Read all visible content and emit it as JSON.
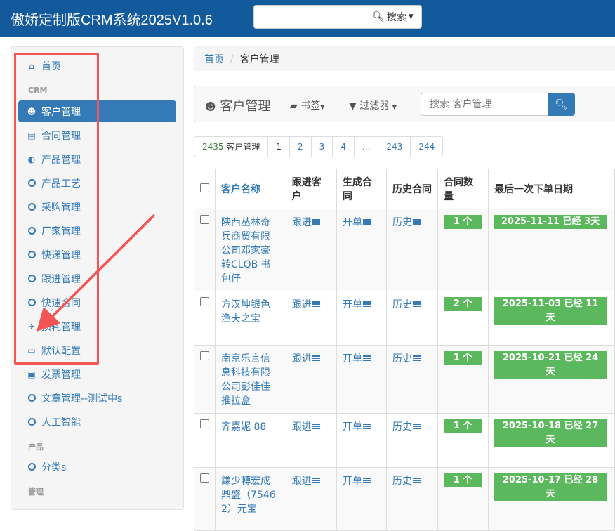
{
  "header": {
    "title": "傲娇定制版CRM系统2025V1.0.6",
    "search_value": "",
    "search_button": "搜索"
  },
  "sidebar": {
    "items": [
      {
        "label": "首页",
        "icon": "home-icon"
      },
      {
        "header": "CRM"
      },
      {
        "label": "客户管理",
        "icon": "user-icon",
        "active": true
      },
      {
        "label": "合同管理",
        "icon": "file-icon"
      },
      {
        "label": "产品管理",
        "icon": "adjust-icon"
      },
      {
        "label": "产品工艺",
        "icon": "circle-icon"
      },
      {
        "label": "采购管理",
        "icon": "circle-icon"
      },
      {
        "label": "厂家管理",
        "icon": "circle-icon"
      },
      {
        "label": "快递管理",
        "icon": "circle-icon"
      },
      {
        "label": "跟进管理",
        "icon": "circle-icon"
      },
      {
        "label": "快速合同",
        "icon": "circle-icon"
      },
      {
        "label": "损耗管理",
        "icon": "plane-icon"
      },
      {
        "label": "默认配置",
        "icon": "laptop-icon"
      },
      {
        "label": "发票管理",
        "icon": "money-icon"
      },
      {
        "label": "文章管理--测试中s",
        "icon": "circle-icon"
      },
      {
        "label": "人工智能",
        "icon": "circle-icon"
      },
      {
        "header": "产品"
      },
      {
        "label": "分类s",
        "icon": "circle-icon"
      },
      {
        "header": "管理"
      }
    ]
  },
  "breadcrumb": {
    "home": "首页",
    "current": "客户管理"
  },
  "toolbar": {
    "title": "客户管理",
    "bookmarks": "书签",
    "filter": "过滤器",
    "search_placeholder": "搜索 客户管理"
  },
  "pagination": {
    "total": "2435",
    "total_label": "客户管理",
    "pages": [
      "1",
      "2",
      "3",
      "4",
      "...",
      "243",
      "244"
    ],
    "current": "1"
  },
  "table": {
    "headers": [
      "客户名称",
      "跟进客户",
      "生成合同",
      "历史合同",
      "合同数量",
      "最后一次下单日期"
    ],
    "action_labels": {
      "follow": "跟进",
      "order": "开单",
      "history": "历史"
    },
    "rows": [
      {
        "name": "陕西丛林奇兵商贸有限公司邓家豪 转CLQB 书包仔",
        "count": "1 个",
        "last": "2025-11-11 已经 3天"
      },
      {
        "name": "方汉坤银色渔夫之宝",
        "count": "2 个",
        "last": "2025-11-03 已经 11天"
      },
      {
        "name": "南京乐言信息科技有限公司彭佳佳 推拉盒",
        "count": "1 个",
        "last": "2025-10-21 已经 24天"
      },
      {
        "name": "齐嘉妮 88",
        "count": "1 个",
        "last": "2025-10-18 已经 27天"
      },
      {
        "name": "鎌少轉宏成鼎盛（75462）元宝",
        "count": "1 个",
        "last": "2025-10-17 已经 28天"
      }
    ]
  },
  "colors": {
    "navbar": "#125a9b",
    "primary": "#337ab7",
    "success": "#5cb85c",
    "annotation": "#f55454"
  }
}
